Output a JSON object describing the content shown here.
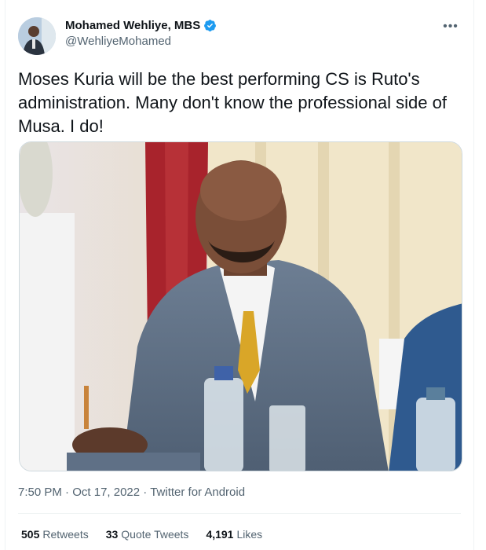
{
  "author": {
    "display_name": "Mohamed Wehliye, MBS",
    "handle": "@WehliyeMohamed",
    "verified": true
  },
  "icons": {
    "more": "more-horizontal-icon",
    "verified": "verified-badge-icon"
  },
  "tweet": {
    "text": "Moses Kuria will be the best performing CS is Ruto's administration. Many don't know the professional side of Musa. I do!"
  },
  "meta": {
    "time": "7:50 PM",
    "sep1": " · ",
    "date": "Oct 17, 2022",
    "sep2": " · ",
    "source": "Twitter for Android"
  },
  "stats": {
    "retweets_count": "505",
    "retweets_label": "Retweets",
    "quotes_count": "33",
    "quotes_label": "Quote Tweets",
    "likes_count": "4,191",
    "likes_label": "Likes"
  },
  "colors": {
    "accent": "#1d9bf0",
    "text_primary": "#0f1419",
    "text_secondary": "#536471"
  }
}
